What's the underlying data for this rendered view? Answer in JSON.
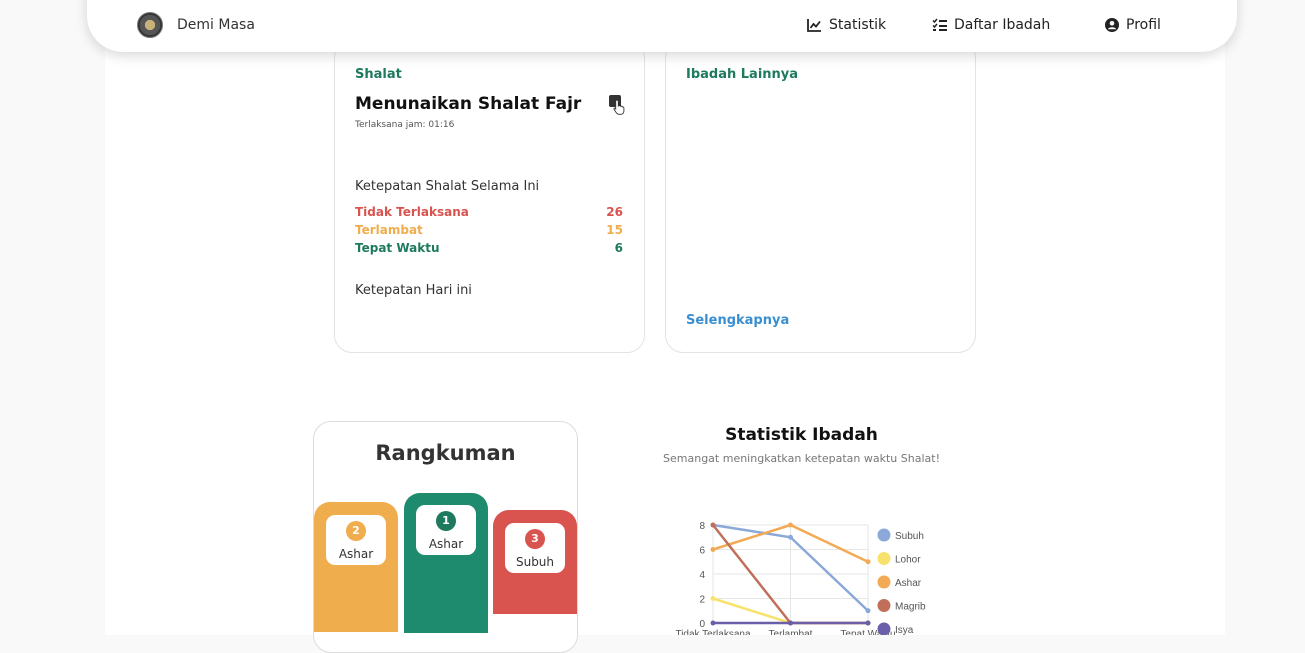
{
  "nav": {
    "brand": "Demi Masa",
    "items": [
      {
        "label": "Statistik",
        "icon": "chart-line-icon"
      },
      {
        "label": "Daftar Ibadah",
        "icon": "checklist-icon"
      },
      {
        "label": "Profil",
        "icon": "user-circle-icon"
      }
    ]
  },
  "shalat_card": {
    "label": "Shalat",
    "task_title": "Menunaikan Shalat Fajr",
    "task_meta": "Terlaksana jam:  01:16",
    "summary_heading": "Ketepatan Shalat Selama Ini",
    "stats": [
      {
        "label": "Tidak Terlaksana",
        "value": "26",
        "color": "#d9534f"
      },
      {
        "label": "Terlambat",
        "value": "15",
        "color": "#f0ad4e"
      },
      {
        "label": "Tepat Waktu",
        "value": "6",
        "color": "#1e7a5e"
      }
    ],
    "today_heading": "Ketepatan Hari ini"
  },
  "lain_card": {
    "label": "Ibadah Lainnya",
    "more_link": "Selengkapnya"
  },
  "rangkuman": {
    "title": "Rangkuman",
    "podium": [
      {
        "rank": "2",
        "name": "Ashar",
        "color": "#f0ad4e"
      },
      {
        "rank": "1",
        "name": "Ashar",
        "color": "#1e8a6e"
      },
      {
        "rank": "3",
        "name": "Subuh",
        "color": "#d9534f"
      }
    ]
  },
  "statistik": {
    "title": "Statistik Ibadah",
    "subtitle": "Semangat meningkatkan ketepatan waktu Shalat!"
  },
  "chart_data": {
    "type": "line",
    "categories": [
      "Tidak Terlaksana",
      "Terlambat",
      "Tepat Waktu"
    ],
    "ylim": [
      0,
      8
    ],
    "yticks": [
      "0",
      "2",
      "4",
      "6",
      "8"
    ],
    "grid": true,
    "legend_position": "right",
    "series": [
      {
        "name": "Subuh",
        "color": "#8aa8d8",
        "values": [
          8,
          7,
          1
        ]
      },
      {
        "name": "Lohor",
        "color": "#f7e26b",
        "values": [
          2,
          0,
          0
        ]
      },
      {
        "name": "Ashar",
        "color": "#f2aa55",
        "values": [
          6,
          8,
          5
        ]
      },
      {
        "name": "Magrib",
        "color": "#c0705a",
        "values": [
          8,
          0,
          0
        ]
      },
      {
        "name": "Isya",
        "color": "#6a5fa8",
        "values": [
          0,
          0,
          0
        ]
      }
    ]
  }
}
